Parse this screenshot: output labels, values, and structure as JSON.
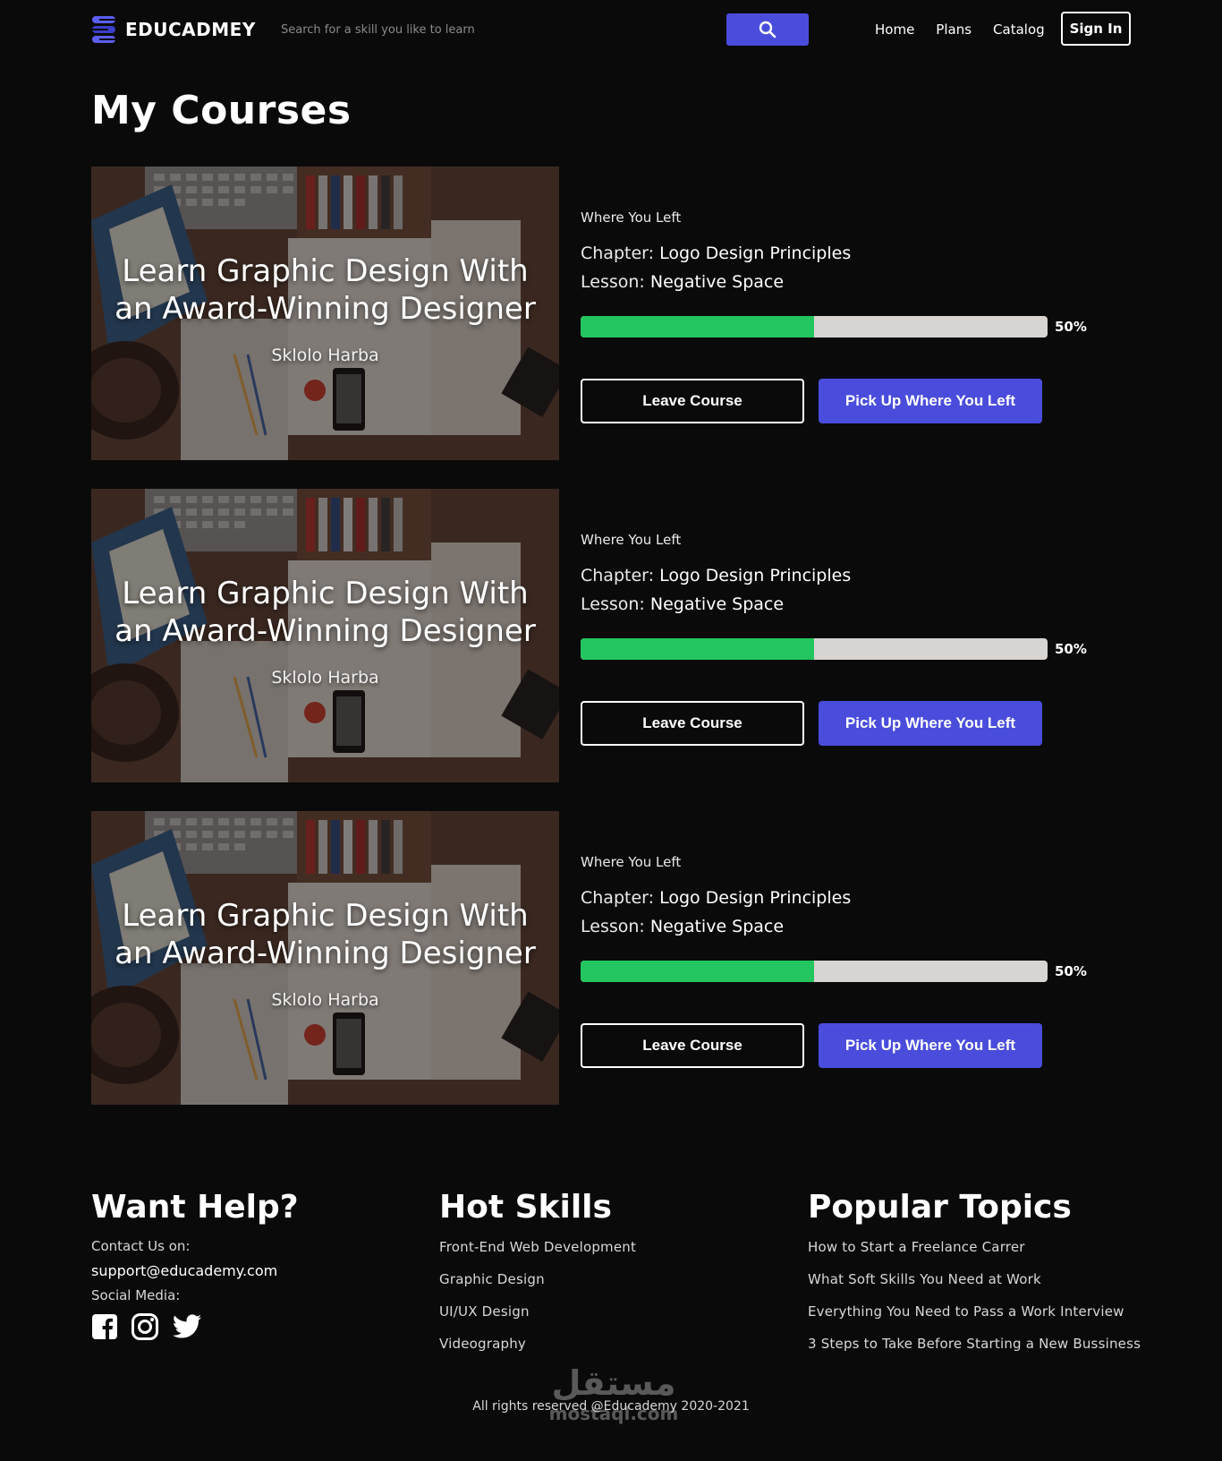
{
  "brand": {
    "name": "EDUCADMEY",
    "logo_icon": "stacked-s-logo-icon",
    "accent": "#4a4ddb"
  },
  "search": {
    "placeholder": "Search for a skill you like to learn",
    "value": "",
    "icon": "search-icon"
  },
  "nav": {
    "links": [
      "Home",
      "Plans",
      "Catalog"
    ],
    "signin_label": "Sign In"
  },
  "page": {
    "title": "My Courses"
  },
  "courses": [
    {
      "title": "Learn Graphic Design With an Award-Winning Designer",
      "title_line1": "Learn Graphic Design With",
      "title_line2": "an Award-Winning Designer",
      "author": "Sklolo Harba",
      "where_label": "Where You Left",
      "chapter_label": "Chapter:",
      "chapter_value": "Logo Design Principles",
      "lesson_label": "Lesson:",
      "lesson_value": "Negative Space",
      "progress": 0.5,
      "progress_text": "50%",
      "leave_label": "Leave Course",
      "pickup_label": "Pick Up Where You Left"
    },
    {
      "title": "Learn Graphic Design With an Award-Winning Designer",
      "title_line1": "Learn Graphic Design With",
      "title_line2": "an Award-Winning Designer",
      "author": "Sklolo Harba",
      "where_label": "Where You Left",
      "chapter_label": "Chapter:",
      "chapter_value": "Logo Design Principles",
      "lesson_label": "Lesson:",
      "lesson_value": "Negative Space",
      "progress": 0.5,
      "progress_text": "50%",
      "leave_label": "Leave Course",
      "pickup_label": "Pick Up Where You Left"
    },
    {
      "title": "Learn Graphic Design With an Award-Winning Designer",
      "title_line1": "Learn Graphic Design With",
      "title_line2": "an Award-Winning Designer",
      "author": "Sklolo Harba",
      "where_label": "Where You Left",
      "chapter_label": "Chapter:",
      "chapter_value": "Logo Design Principles",
      "lesson_label": "Lesson:",
      "lesson_value": "Negative Space",
      "progress": 0.5,
      "progress_text": "50%",
      "leave_label": "Leave Course",
      "pickup_label": "Pick Up Where You Left"
    }
  ],
  "footer": {
    "help": {
      "heading": "Want Help?",
      "contact_label": "Contact Us on:",
      "email": "support@educademy.com",
      "social_label": "Social Media:",
      "social_icons": [
        "facebook-icon",
        "instagram-icon",
        "twitter-icon"
      ]
    },
    "skills": {
      "heading": "Hot Skills",
      "items": [
        "Front-End Web Development",
        "Graphic Design",
        "UI/UX Design",
        "Videography"
      ]
    },
    "topics": {
      "heading": "Popular Topics",
      "items": [
        "How to Start a Freelance Carrer",
        "What Soft Skills You Need at Work",
        "Everything You Need to Pass a Work Interview",
        "3 Steps to Take Before Starting a New Bussiness"
      ]
    },
    "copyright": "All rights reserved @Educademy 2020-2021",
    "watermark": {
      "arabic": "مستقل",
      "latin": "mostaql.com"
    }
  },
  "colors": {
    "background": "#0a0a0a",
    "accent": "#4a4ddb",
    "progress_fill": "#22c55e",
    "progress_track": "#d8d4d2"
  }
}
